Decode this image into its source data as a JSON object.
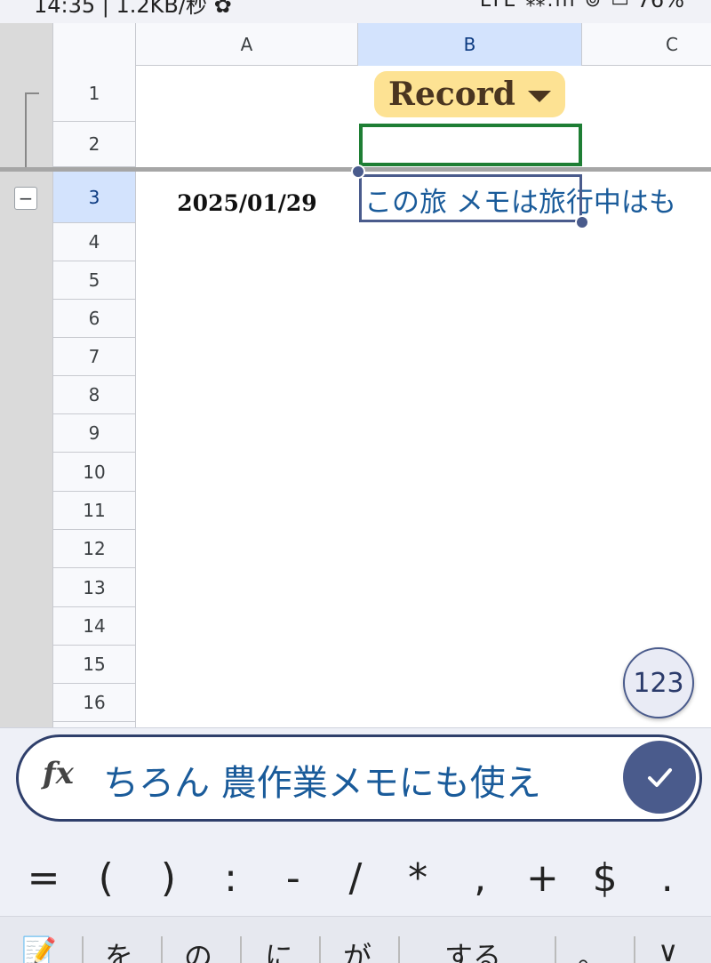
{
  "status_bar": {
    "time_speed": "14:35 | 1.2KB/秒 ✿",
    "battery": "76%",
    "icons": "LTE ⁂.ıll ⊚ ▭"
  },
  "columns": [
    {
      "id": "A",
      "label": "A"
    },
    {
      "id": "B",
      "label": "B",
      "selected": true
    },
    {
      "id": "C",
      "label": "C"
    }
  ],
  "rows": [
    "1",
    "2",
    "3",
    "4",
    "5",
    "6",
    "7",
    "8",
    "9",
    "10",
    "11",
    "12",
    "13",
    "14",
    "15",
    "16"
  ],
  "selected_row": "3",
  "group_toggle": "−",
  "cells": {
    "b1_dropdown": "Record",
    "a3_date": "2025/01/29",
    "b3_text": "この旅 メモは旅行中はも"
  },
  "fab_label": "123",
  "formula_bar": {
    "fx_label": "fx",
    "content": "ちろん 農作業メモにも使え"
  },
  "symbol_keys": [
    "=",
    "(",
    ")",
    ":",
    "-",
    "/",
    "*",
    ",",
    "+",
    "$",
    "."
  ],
  "ime_candidates": [
    "📝",
    "を",
    "の",
    "に",
    "が",
    "する",
    "。",
    "∨"
  ],
  "colors": {
    "accent": "#4a5b8c",
    "dropdown_bg": "#fde293",
    "selection_green": "#1e7e34",
    "text_blue": "#1a5b9a"
  }
}
